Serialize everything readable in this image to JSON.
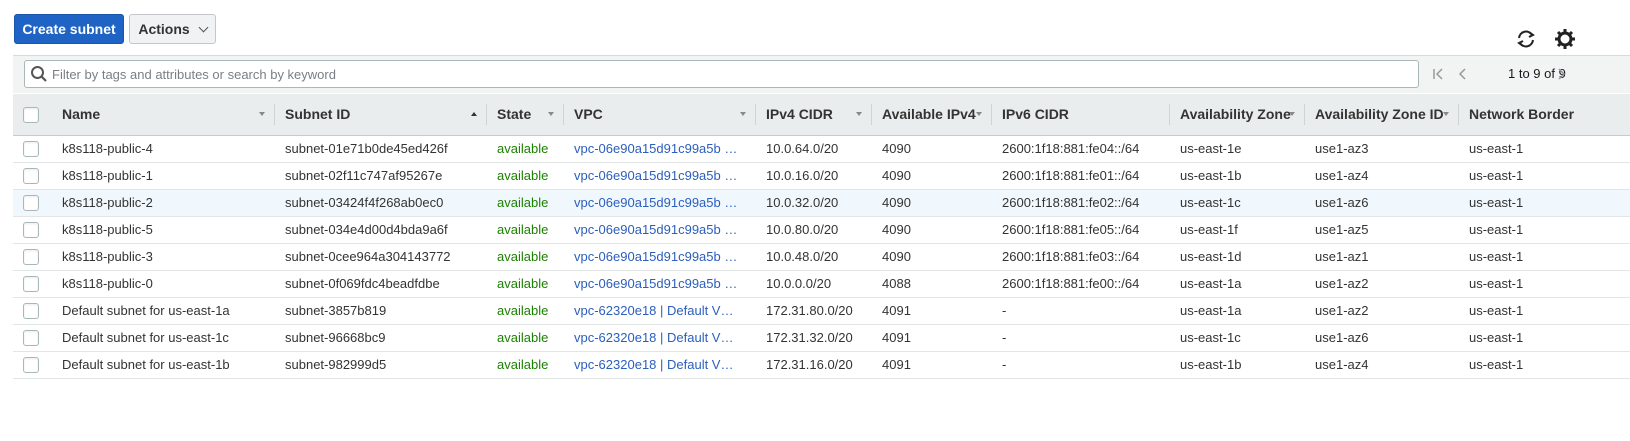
{
  "toolbar": {
    "create_label": "Create subnet",
    "actions_label": "Actions",
    "refresh_icon": "refresh-icon",
    "settings_icon": "gear-icon"
  },
  "search": {
    "placeholder": "Filter by tags and attributes or search by keyword"
  },
  "pagination": {
    "text": "1 to 9 of 9"
  },
  "table": {
    "columns": [
      "Name",
      "Subnet ID",
      "State",
      "VPC",
      "IPv4 CIDR",
      "Available IPv4",
      "IPv6 CIDR",
      "Availability Zone",
      "Availability Zone ID",
      "Network Border"
    ],
    "rows": [
      [
        "k8s118-public-4",
        "subnet-01e71b0de45ed426f",
        "available",
        "vpc-06e90a15d91c99a5b …",
        "10.0.64.0/20",
        "4090",
        "2600:1f18:881:fe04::/64",
        "us-east-1e",
        "use1-az3",
        "us-east-1"
      ],
      [
        "k8s118-public-1",
        "subnet-02f11c747af95267e",
        "available",
        "vpc-06e90a15d91c99a5b …",
        "10.0.16.0/20",
        "4090",
        "2600:1f18:881:fe01::/64",
        "us-east-1b",
        "use1-az4",
        "us-east-1"
      ],
      [
        "k8s118-public-2",
        "subnet-03424f4f268ab0ec0",
        "available",
        "vpc-06e90a15d91c99a5b …",
        "10.0.32.0/20",
        "4090",
        "2600:1f18:881:fe02::/64",
        "us-east-1c",
        "use1-az6",
        "us-east-1"
      ],
      [
        "k8s118-public-5",
        "subnet-034e4d00d4bda9a6f",
        "available",
        "vpc-06e90a15d91c99a5b …",
        "10.0.80.0/20",
        "4090",
        "2600:1f18:881:fe05::/64",
        "us-east-1f",
        "use1-az5",
        "us-east-1"
      ],
      [
        "k8s118-public-3",
        "subnet-0cee964a304143772",
        "available",
        "vpc-06e90a15d91c99a5b …",
        "10.0.48.0/20",
        "4090",
        "2600:1f18:881:fe03::/64",
        "us-east-1d",
        "use1-az1",
        "us-east-1"
      ],
      [
        "k8s118-public-0",
        "subnet-0f069fdc4beadfdbe",
        "available",
        "vpc-06e90a15d91c99a5b …",
        "10.0.0.0/20",
        "4088",
        "2600:1f18:881:fe00::/64",
        "us-east-1a",
        "use1-az2",
        "us-east-1"
      ],
      [
        "Default subnet for us-east-1a",
        "subnet-3857b819",
        "available",
        "vpc-62320e18 | Default V…",
        "172.31.80.0/20",
        "4091",
        "-",
        "us-east-1a",
        "use1-az2",
        "us-east-1"
      ],
      [
        "Default subnet for us-east-1c",
        "subnet-96668bc9",
        "available",
        "vpc-62320e18 | Default V…",
        "172.31.32.0/20",
        "4091",
        "-",
        "us-east-1c",
        "use1-az6",
        "us-east-1"
      ],
      [
        "Default subnet for us-east-1b",
        "subnet-982999d5",
        "available",
        "vpc-62320e18 | Default V…",
        "172.31.16.0/20",
        "4091",
        "-",
        "us-east-1b",
        "use1-az4",
        "us-east-1"
      ]
    ]
  },
  "colors": {
    "primary": "#1f64c4",
    "available": "#1d8102",
    "link": "#2b5ebd"
  }
}
